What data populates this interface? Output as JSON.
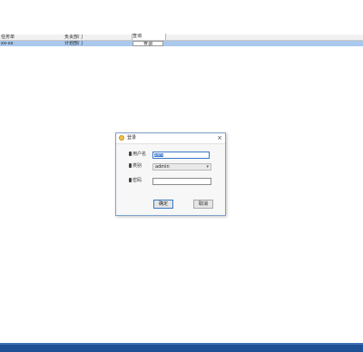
{
  "table": {
    "headers": [
      "任务单",
      "负责部门",
      "查询"
    ],
    "row": {
      "col1": "xx-xx",
      "col2": "计划部门",
      "col3": "查询"
    }
  },
  "dialog": {
    "title": "登录",
    "labels": {
      "id": "用户名",
      "type": "类别",
      "password": "密码"
    },
    "id_value": "admin",
    "type_value": "admin",
    "ok_label": "确定",
    "cancel_label": "取消",
    "close_glyph": "×"
  },
  "colors": {
    "selected_row": "#a9c8ec",
    "taskbar": "#1f4f94",
    "accent": "#3a78c8"
  }
}
